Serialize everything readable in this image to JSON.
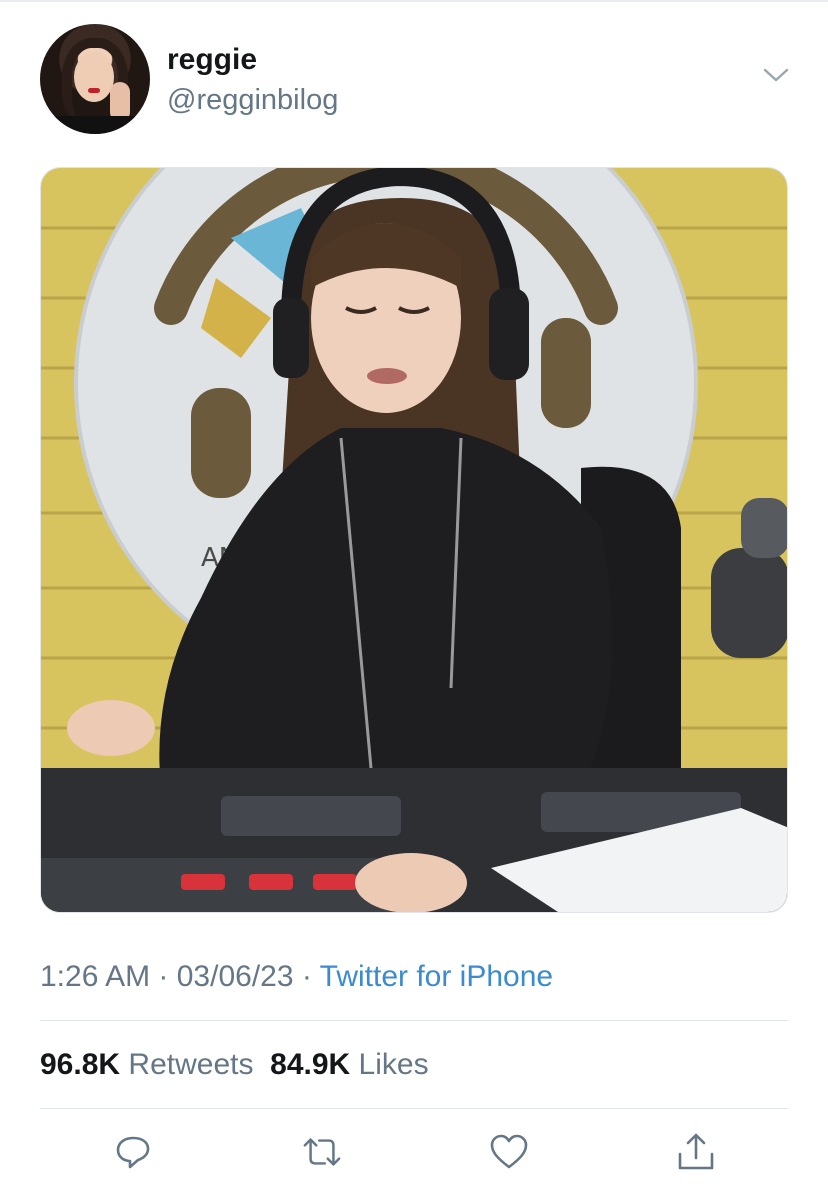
{
  "author": {
    "display_name": "reggie",
    "handle": "@regginbilog"
  },
  "photo": {
    "sign_text": "AN A"
  },
  "meta": {
    "time": "1:26 AM",
    "separator1": " · ",
    "date": "03/06/23",
    "separator2": " · ",
    "source": "Twitter for iPhone"
  },
  "stats": {
    "retweets_count": "96.8K",
    "retweets_label": "Retweets",
    "likes_count": "84.9K",
    "likes_label": "Likes"
  },
  "icons": {
    "menu": "chevron-down-icon",
    "reply": "reply-icon",
    "retweet": "retweet-icon",
    "like": "heart-icon",
    "share": "share-icon"
  },
  "colors": {
    "link": "#3b8bd0",
    "secondary_text": "#657786",
    "icon": "#657786"
  }
}
